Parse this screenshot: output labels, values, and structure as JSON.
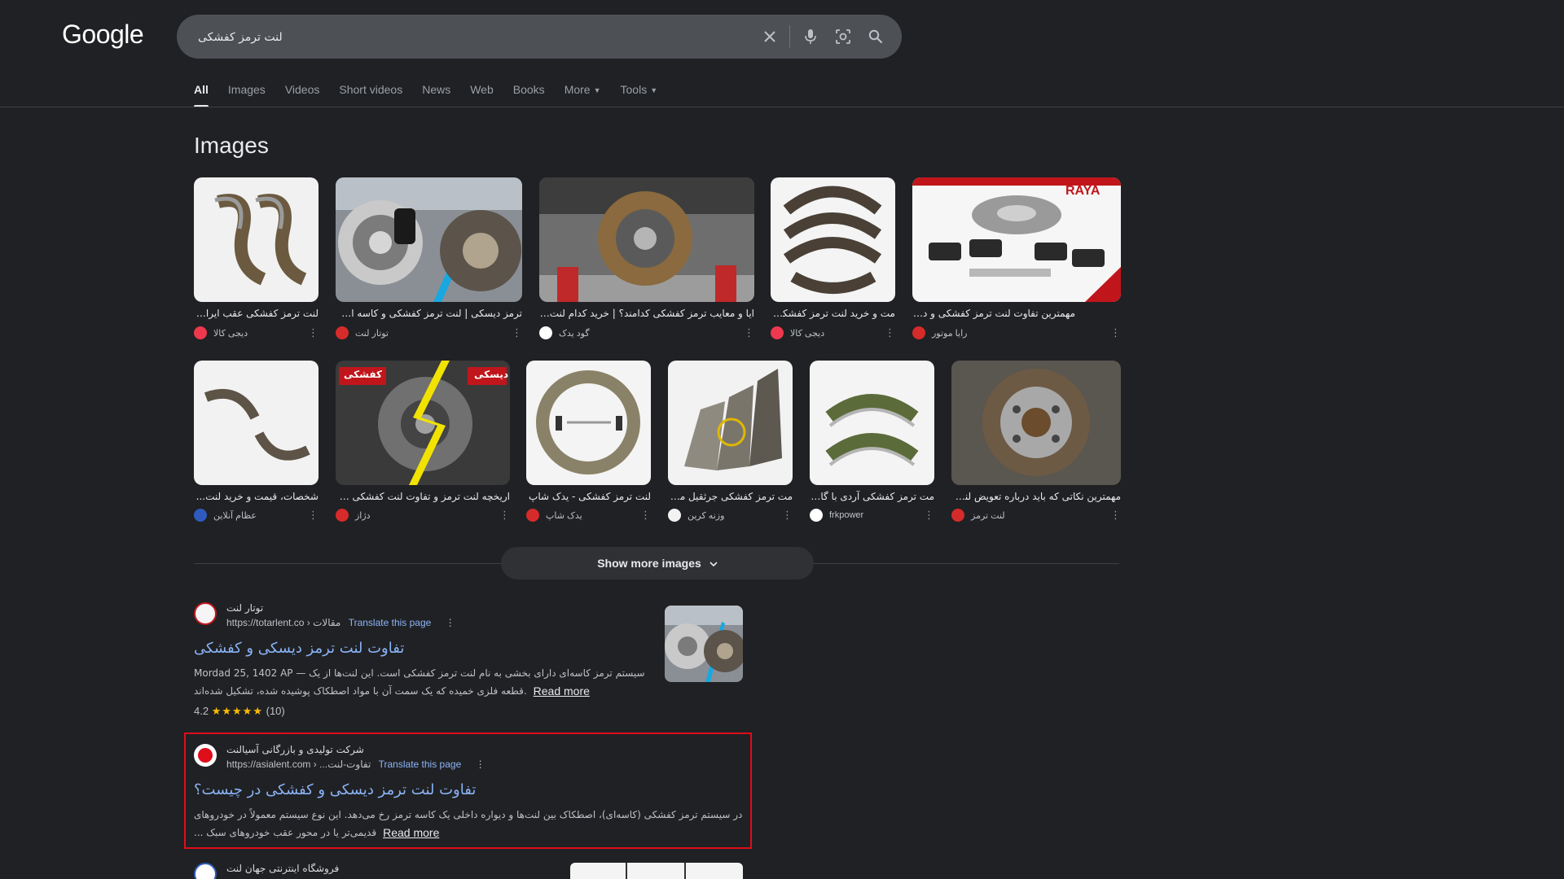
{
  "header": {
    "logo": "Google",
    "search": {
      "value": "لنت ترمز کفشکی",
      "placeholder": ""
    },
    "icons": [
      "close-icon",
      "mic-icon",
      "lens-icon",
      "search-icon"
    ]
  },
  "tabs": [
    {
      "label": "All",
      "active": true
    },
    {
      "label": "Images"
    },
    {
      "label": "Videos"
    },
    {
      "label": "Short videos"
    },
    {
      "label": "News"
    },
    {
      "label": "Web"
    },
    {
      "label": "Books"
    },
    {
      "label": "More",
      "caret": true
    },
    {
      "label": "Tools",
      "caret": true
    }
  ],
  "images": {
    "title": "Images",
    "row1": [
      {
        "caption": "لنت ترمز کفشکی عقب ایران...",
        "source": "دیجی کالا"
      },
      {
        "caption": "ترمز دیسکی | لنت ترمز کفشکی و کاسه ای ...",
        "source": "توتار لنت"
      },
      {
        "caption": "ایا و معایب ترمز کفشکی کدامند؟ | خرید کدام لنت تر...",
        "source": "گود یدک"
      },
      {
        "caption": "مت و خرید لنت ترمز کفشکی...",
        "source": "دیجی کالا"
      },
      {
        "caption": "مهمترین تفاوت لنت ترمز کفشکی و دیسکی",
        "source": "رایا موتور"
      }
    ],
    "row2": [
      {
        "caption": "شخصات، قیمت و خرید لنت...",
        "source": "عظام آنلاین"
      },
      {
        "caption": "اریخچه لنت ترمز و تفاوت لنت کفشکی و د...",
        "source": "دژاز"
      },
      {
        "caption": "لنت ترمز کفشکی - یدک شاپ",
        "source": "یدک شاپ"
      },
      {
        "caption": "مت ترمز کفشکی جرثقیل مدل...",
        "source": "وزنه کرین"
      },
      {
        "caption": "مت ترمز کفشکی آردی با گارا...",
        "source": "frkpower"
      },
      {
        "caption": "مهمترین نکاتی که باید درباره تعویض لنت...",
        "source": "لنت ترمز"
      }
    ],
    "show_more": "Show more images",
    "badge_kafshki": "کفشکی",
    "badge_disky": "دیسکی",
    "brand_raya": "RAYA"
  },
  "results": [
    {
      "site_name": "توتار لنت",
      "url": "https://totarlent.co › مقالات",
      "translate": "Translate this page",
      "title": "تفاوت لنت ترمز دیسکی و کفشکی",
      "snippet_line1": "Mordad 25, 1402 AP — سیستم ترمز کاسه‌ای دارای بخشی به نام لنت ترمز کفشکی است. این لنت‌ها از یک",
      "snippet_line2": "قطعه فلزی خمیده که یک سمت آن با مواد اصطکاک پوشیده شده، تشکیل شده‌اند.",
      "read_more": "Read more",
      "rating_value": "4.2",
      "rating_stars": "★★★★★",
      "rating_count": "(10)"
    },
    {
      "site_name": "شرکت تولیدی و بازرگانی آسیالنت",
      "url": "https://asialent.com › ...تفاوت-لنت",
      "translate": "Translate this page",
      "title": "تفاوت لنت ترمز دیسکی و کفشکی در چیست؟",
      "snippet_line1": "در سیستم ترمز کفشکی (کاسه‌ای)، اصطکاک بین لنت‌ها و دیواره داخلی یک کاسه ترمز رخ می‌دهد. این نوع سیستم معمولاً در خودروهای",
      "snippet_line2": "... قدیمی‌تر یا در محور عقب خودروهای سبک",
      "read_more": "Read more"
    },
    {
      "site_name": "فروشگاه اینترنتی جهان لنت"
    }
  ],
  "colors": {
    "background": "#202124",
    "link": "#8ab4f8",
    "highlight": "#e00d1b"
  }
}
